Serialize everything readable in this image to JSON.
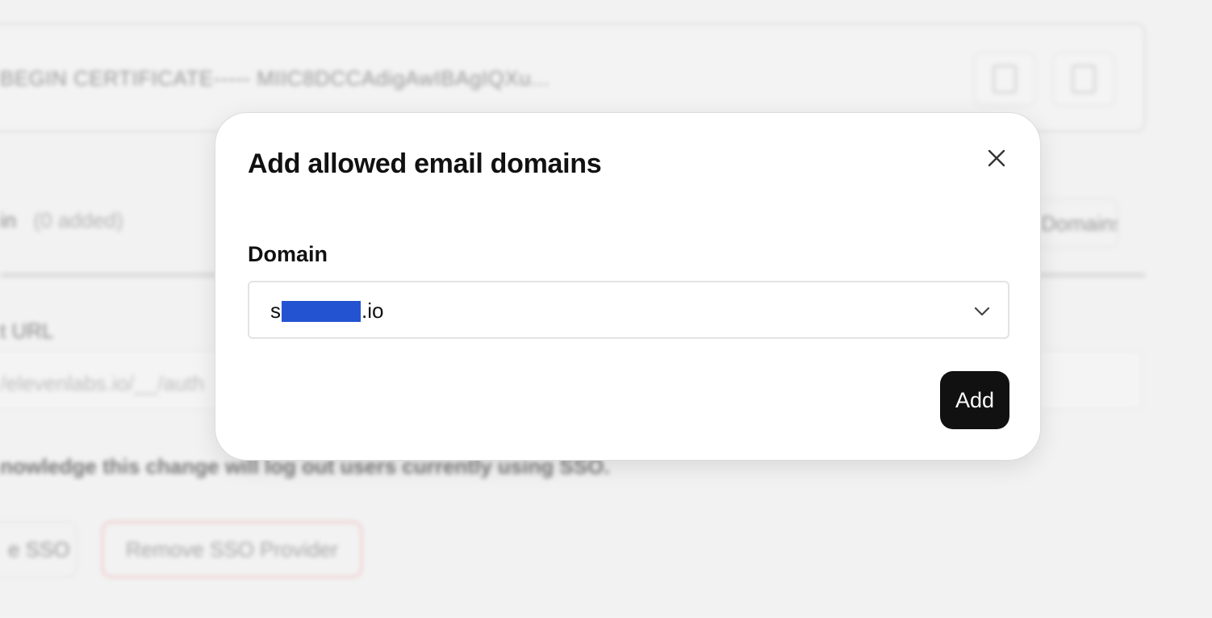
{
  "background": {
    "certificate_text": "BEGIN CERTIFICATE----- MIIC8DCCAdigAwIBAgIQXu...",
    "allowed_domains_label": "in",
    "allowed_domains_count": "(0 added)",
    "add_domains_button": "Domains",
    "acs_url_label": "t URL",
    "acs_url_value": "/elevenlabs.io/__/auth",
    "acknowledge_text": "nowledge this change will log out users currently using SSO.",
    "update_sso_button": "e SSO",
    "remove_sso_button": "Remove SSO Provider"
  },
  "modal": {
    "title": "Add allowed email domains",
    "close_icon": "close-icon",
    "field_label": "Domain",
    "select": {
      "value_prefix": "s",
      "value_suffix": ".io",
      "icon": "chevron-down-icon"
    },
    "add_button": "Add"
  },
  "colors": {
    "primary_button": "#111111",
    "redaction": "#2453d1",
    "danger_outline": "#f0b6b6"
  }
}
